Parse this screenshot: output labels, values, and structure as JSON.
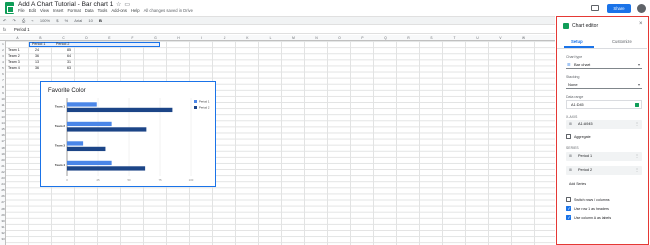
{
  "titlebar": {
    "doc_title": "Add A Chart Tutorial - Bar chart 1",
    "star_icon": "star-icon",
    "folder_icon": "folder-icon",
    "share_label": "Share"
  },
  "menu": [
    "File",
    "Edit",
    "View",
    "Insert",
    "Format",
    "Data",
    "Tools",
    "Add-ons",
    "Help"
  ],
  "saved_status": "All changes saved in Drive",
  "toolbar": {
    "zoom": "100%",
    "currency": "$",
    "percent": "%",
    "font": "Arial",
    "font_size": "10",
    "bold": "B"
  },
  "formula": {
    "fx": "fx",
    "value": "Period 1"
  },
  "columns": [
    "A",
    "B",
    "C",
    "D",
    "E",
    "F",
    "G",
    "H",
    "I",
    "J",
    "K",
    "L",
    "M",
    "N",
    "O",
    "P",
    "Q",
    "R",
    "S",
    "T",
    "U",
    "V",
    "W"
  ],
  "rows": [
    "1",
    "2",
    "3",
    "4",
    "5",
    "6",
    "7",
    "8",
    "9",
    "10",
    "11",
    "12",
    "13",
    "14",
    "15",
    "16",
    "17",
    "18",
    "19",
    "20",
    "21",
    "22",
    "23",
    "24",
    "25",
    "26",
    "27",
    "28",
    "29",
    "30",
    "31",
    "32",
    "33"
  ],
  "sheet": {
    "header": [
      "",
      "Period 1",
      "Period 2"
    ],
    "data": [
      [
        "Team 1",
        "24",
        "85"
      ],
      [
        "Team 2",
        "36",
        "64"
      ],
      [
        "Team 3",
        "13",
        "31"
      ],
      [
        "Team 4",
        "36",
        "63"
      ]
    ]
  },
  "chart_data": {
    "type": "bar",
    "title": "Favorite Color",
    "categories": [
      "Team 1",
      "Team 2",
      "Team 3",
      "Team 4"
    ],
    "series": [
      {
        "name": "Period 1",
        "values": [
          24,
          36,
          13,
          36
        ],
        "color": "#4a86e8"
      },
      {
        "name": "Period 2",
        "values": [
          85,
          64,
          31,
          63
        ],
        "color": "#1c4587"
      }
    ],
    "xlim": [
      0,
      100
    ],
    "ticks": [
      "0",
      "25",
      "50",
      "75",
      "100"
    ],
    "legend": "right"
  },
  "editor": {
    "title": "Chart editor",
    "close_icon": "close-icon",
    "tabs": [
      "Setup",
      "Customize"
    ],
    "chart_type_label": "Chart type",
    "chart_type_value": "Bar chart",
    "stacking_label": "Stacking",
    "stacking_value": "None",
    "data_range_label": "Data range",
    "data_range_value": "A1:D45",
    "x_axis_label": "X-AXIS",
    "x_axis_value": "A1:A945",
    "aggregate_label": "Aggregate",
    "series_label": "SERIES",
    "series": [
      "Period 1",
      "Period 2"
    ],
    "add_series": "Add Series",
    "switch_rows": "Switch rows / columns",
    "use_row_headers": "Use row 1 as headers",
    "use_col_labels": "Use column A as labels"
  }
}
